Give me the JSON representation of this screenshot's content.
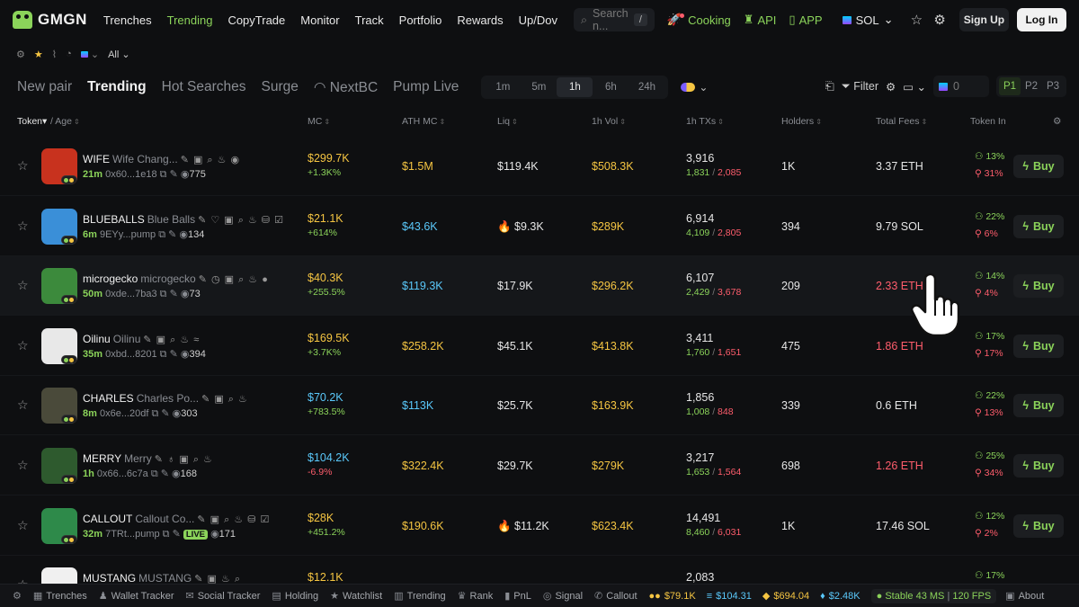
{
  "nav": {
    "logo": "GMGN",
    "links": [
      "Trenches",
      "Trending",
      "CopyTrade",
      "Monitor",
      "Track",
      "Portfolio",
      "Rewards",
      "Up/Dov"
    ],
    "active_link": "Trending",
    "search_placeholder": "Search n...",
    "search_shortcut": "/",
    "cooking": "Cooking",
    "api": "API",
    "app": "APP",
    "chain": "SOL",
    "signup": "Sign Up",
    "login": "Log In"
  },
  "subbar": {
    "filter_all": "All"
  },
  "tabs": [
    "New pair",
    "Trending",
    "Hot Searches",
    "Surge",
    "NextBC",
    "Pump Live"
  ],
  "active_tab": "Trending",
  "timeframes": [
    "1m",
    "5m",
    "1h",
    "6h",
    "24h"
  ],
  "active_timeframe": "1h",
  "filters": {
    "filter_label": "Filter",
    "amount_value": "0",
    "pages": [
      "P1",
      "P2",
      "P3"
    ],
    "active_page": "P1"
  },
  "columns": {
    "token": "Token",
    "age": "Age",
    "mc": "MC",
    "ath_mc": "ATH MC",
    "liq": "Liq",
    "vol": "1h Vol",
    "txs": "1h TXs",
    "holders": "Holders",
    "fees": "Total Fees",
    "influence": "Token In"
  },
  "rows": [
    {
      "symbol": "WIFE",
      "name": "Wife Chang...",
      "icons": "✎ ▣ ⌕ ♨ ◉",
      "age": "21m",
      "address": "0x60...1e18",
      "watchers": "775",
      "mc": "$299.7K",
      "mc_change": "+1.3K%",
      "ath_mc": "$1.5M",
      "liq": "$119.4K",
      "vol": "$508.3K",
      "txs": "3,916",
      "buys": "1,831",
      "sells": "2,085",
      "holders": "1K",
      "fees": "3.37 ETH",
      "inf_up": "13%",
      "inf_down": "31%",
      "buy": "Buy",
      "avatar_color": "#c8321e",
      "mc_color": "yellow",
      "ath_color": "yellow",
      "fees_color": "white",
      "mc_negative": false,
      "hover": false
    },
    {
      "symbol": "BLUEBALLS",
      "name": "Blue Balls",
      "icons": "✎ ♡ ▣ ⌕ ♨ ⛁ ☑",
      "age": "6m",
      "address": "9EYy...pump",
      "watchers": "134",
      "mc": "$21.1K",
      "mc_change": "+614%",
      "ath_mc": "$43.6K",
      "liq": "🔥 $9.3K",
      "vol": "$289K",
      "txs": "6,914",
      "buys": "4,109",
      "sells": "2,805",
      "holders": "394",
      "fees": "9.79 SOL",
      "inf_up": "22%",
      "inf_down": "6%",
      "buy": "Buy",
      "avatar_color": "#3a8fd8",
      "mc_color": "yellow",
      "ath_color": "blue",
      "fees_color": "white",
      "mc_negative": false,
      "hover": false
    },
    {
      "symbol": "microgecko",
      "name": "microgecko",
      "icons": "✎ ◷ ▣ ⌕ ♨ ●",
      "age": "50m",
      "address": "0xde...7ba3",
      "watchers": "73",
      "mc": "$40.3K",
      "mc_change": "+255.5%",
      "ath_mc": "$119.3K",
      "liq": "$17.9K",
      "vol": "$296.2K",
      "txs": "6,107",
      "buys": "2,429",
      "sells": "3,678",
      "holders": "209",
      "fees": "2.33 ETH",
      "inf_up": "14%",
      "inf_down": "4%",
      "buy": "Buy",
      "avatar_color": "#3c8a3c",
      "mc_color": "yellow",
      "ath_color": "blue",
      "fees_color": "red",
      "mc_negative": false,
      "hover": true
    },
    {
      "symbol": "Oilinu",
      "name": "Oilinu",
      "icons": "✎ ▣ ⌕ ♨ ≈",
      "age": "35m",
      "address": "0xbd...8201",
      "watchers": "394",
      "mc": "$169.5K",
      "mc_change": "+3.7K%",
      "ath_mc": "$258.2K",
      "liq": "$45.1K",
      "vol": "$413.8K",
      "txs": "3,411",
      "buys": "1,760",
      "sells": "1,651",
      "holders": "475",
      "fees": "1.86 ETH",
      "inf_up": "17%",
      "inf_down": "17%",
      "buy": "Buy",
      "avatar_color": "#e8e8e8",
      "mc_color": "yellow",
      "ath_color": "yellow",
      "fees_color": "red",
      "mc_negative": false,
      "hover": false
    },
    {
      "symbol": "CHARLES",
      "name": "Charles Po...",
      "icons": "✎ ▣ ⌕ ♨",
      "age": "8m",
      "address": "0x6e...20df",
      "watchers": "303",
      "mc": "$70.2K",
      "mc_change": "+783.5%",
      "ath_mc": "$113K",
      "liq": "$25.7K",
      "vol": "$163.9K",
      "txs": "1,856",
      "buys": "1,008",
      "sells": "848",
      "holders": "339",
      "fees": "0.6 ETH",
      "inf_up": "22%",
      "inf_down": "13%",
      "buy": "Buy",
      "avatar_color": "#4a4a3a",
      "mc_color": "blue",
      "ath_color": "blue",
      "fees_color": "white",
      "mc_negative": false,
      "hover": false
    },
    {
      "symbol": "MERRY",
      "name": "Merry",
      "icons": "✎ ♁ ▣ ⌕ ♨",
      "age": "1h",
      "address": "0x66...6c7a",
      "watchers": "168",
      "mc": "$104.2K",
      "mc_change": "-6.9%",
      "ath_mc": "$322.4K",
      "liq": "$29.7K",
      "vol": "$279K",
      "txs": "3,217",
      "buys": "1,653",
      "sells": "1,564",
      "holders": "698",
      "fees": "1.26 ETH",
      "inf_up": "25%",
      "inf_down": "34%",
      "buy": "Buy",
      "avatar_color": "#2e5a2e",
      "mc_color": "blue",
      "ath_color": "yellow",
      "fees_color": "red",
      "mc_negative": true,
      "hover": false
    },
    {
      "symbol": "CALLOUT",
      "name": "Callout Co...",
      "icons": "✎ ▣ ⌕ ♨ ⛁ ☑",
      "age": "32m",
      "address": "7TRt...pump",
      "watchers": "171",
      "mc": "$28K",
      "mc_change": "+451.2%",
      "ath_mc": "$190.6K",
      "liq": "🔥 $11.2K",
      "vol": "$623.4K",
      "txs": "14,491",
      "buys": "8,460",
      "sells": "6,031",
      "holders": "1K",
      "fees": "17.46 SOL",
      "inf_up": "12%",
      "inf_down": "2%",
      "buy": "Buy",
      "avatar_color": "#2e8a4a",
      "mc_color": "yellow",
      "ath_color": "yellow",
      "fees_color": "white",
      "mc_negative": false,
      "hover": false,
      "live": "LIVE"
    },
    {
      "symbol": "MUSTANG",
      "name": "MUSTANG",
      "icons": "✎ ▣ ♨ ⌕",
      "age": "",
      "address": "",
      "watchers": "",
      "mc": "$12.1K",
      "mc_change": "",
      "ath_mc": "",
      "liq": "",
      "vol": "",
      "txs": "2,083",
      "buys": "",
      "sells": "",
      "holders": "",
      "fees": "",
      "inf_up": "17%",
      "inf_down": "",
      "buy": "",
      "avatar_color": "#f0f0f0",
      "mc_color": "yellow",
      "ath_color": "yellow",
      "fees_color": "white",
      "mc_negative": false,
      "hover": false
    }
  ],
  "bottombar": {
    "items": [
      "Trenches",
      "Wallet Tracker",
      "Social Tracker",
      "Holding",
      "Watchlist",
      "Trending",
      "Rank",
      "PnL",
      "Signal",
      "Callout"
    ],
    "prices": [
      {
        "value": "$79.1K",
        "color": "yellow"
      },
      {
        "value": "$104.31",
        "color": "blue"
      },
      {
        "value": "$694.04",
        "color": "yellow"
      },
      {
        "value": "$2.48K",
        "color": "blue"
      }
    ],
    "stable": "Stable",
    "latency": "43 MS",
    "fps": "120 FPS",
    "about": "About"
  }
}
